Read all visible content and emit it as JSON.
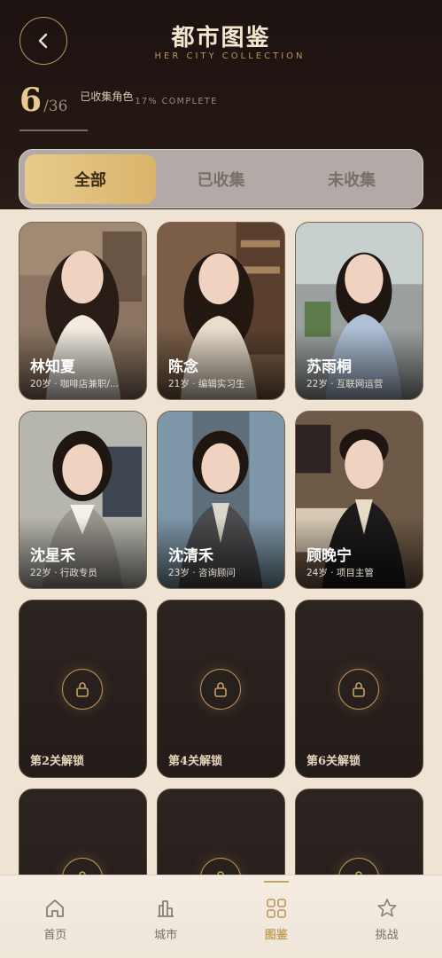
{
  "header": {
    "title": "都市图鉴",
    "subtitle": "HER CITY COLLECTION",
    "collected": "6",
    "total": "/36",
    "collected_label": "已收集角色",
    "complete_label": "17% COMPLETE",
    "progress": 0.17
  },
  "tabs": [
    {
      "label": "全部",
      "active": true
    },
    {
      "label": "已收集",
      "active": false
    },
    {
      "label": "未收集",
      "active": false
    }
  ],
  "unlocked": [
    {
      "name": "林知夏",
      "info": "20岁 · 咖啡店兼职/..."
    },
    {
      "name": "陈念",
      "info": "21岁 · 编辑实习生"
    },
    {
      "name": "苏雨桐",
      "info": "22岁 · 互联网运营"
    },
    {
      "name": "沈星禾",
      "info": "22岁 · 行政专员"
    },
    {
      "name": "沈清禾",
      "info": "23岁 · 咨询顾问"
    },
    {
      "name": "顾晚宁",
      "info": "24岁 · 项目主管"
    }
  ],
  "locked": [
    {
      "label": "第2关解锁"
    },
    {
      "label": "第4关解锁"
    },
    {
      "label": "第6关解锁"
    },
    {
      "label": ""
    },
    {
      "label": ""
    },
    {
      "label": ""
    }
  ],
  "nav": [
    {
      "label": "首页",
      "icon": "home-icon"
    },
    {
      "label": "城市",
      "icon": "city-icon"
    },
    {
      "label": "图鉴",
      "icon": "collection-icon",
      "active": true
    },
    {
      "label": "挑战",
      "icon": "star-icon"
    }
  ],
  "colors": {
    "accent": "#c7a164",
    "dark": "#1c1210"
  }
}
